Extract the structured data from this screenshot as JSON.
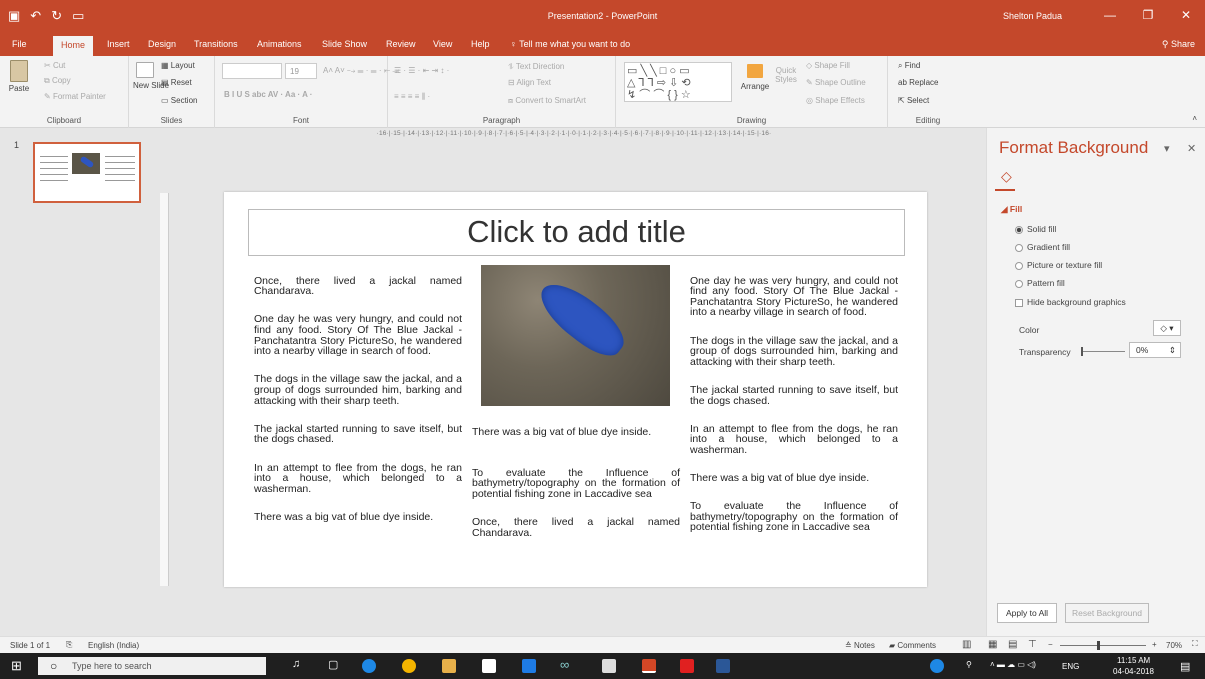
{
  "window": {
    "title": "Presentation2  -  PowerPoint",
    "user": "Shelton Padua"
  },
  "tabs": [
    "File",
    "Home",
    "Insert",
    "Design",
    "Transitions",
    "Animations",
    "Slide Show",
    "Review",
    "View",
    "Help"
  ],
  "tell_me": "Tell me what you want to do",
  "share": "Share",
  "ribbon": {
    "clipboard": {
      "label": "Clipboard",
      "paste": "Paste",
      "cut": "Cut",
      "copy": "Copy",
      "format_painter": "Format Painter"
    },
    "slides": {
      "label": "Slides",
      "new_slide": "New Slide",
      "layout": "Layout",
      "reset": "Reset",
      "section": "Section"
    },
    "font": {
      "label": "Font",
      "size": "19"
    },
    "paragraph": {
      "label": "Paragraph",
      "text_direction": "Text Direction",
      "align_text": "Align Text",
      "convert_smartart": "Convert to SmartArt"
    },
    "drawing": {
      "label": "Drawing",
      "arrange": "Arrange",
      "quick_styles": "Quick Styles",
      "shape_fill": "Shape Fill",
      "shape_outline": "Shape Outline",
      "shape_effects": "Shape Effects"
    },
    "editing": {
      "label": "Editing",
      "find": "Find",
      "replace": "Replace",
      "select": "Select"
    }
  },
  "ruler": "·16·|·15·|·14·|·13·|·12·|·11·|·10·|·9·|·8·|·7·|·6·|·5·|·4·|·3·|·2·|·1·|·0·|·1·|·2·|·3·|·4·|·5·|·6·|·7·|·8·|·9·|·10·|·11·|·12·|·13·|·14·|·15·|·16·",
  "thumb_number": "1",
  "slide": {
    "title_placeholder": "Click to add title",
    "col1": [
      "Once, there lived a jackal named Chandarava.",
      "One day he was very hungry, and could not find any food. Story Of The Blue Jackal - Panchatantra Story PictureSo, he wandered into a nearby village in search of food.",
      "The dogs in the village saw the jackal, and a group of dogs surrounded him, barking and attacking with their sharp teeth.",
      "The jackal started running to save itself, but the dogs chased.",
      "In an attempt to flee from the dogs, he ran into a house, which belonged to a washerman.",
      "There was a big vat of blue dye inside."
    ],
    "col2": [
      "There was a big vat of blue dye inside.",
      "To evaluate the Influence of bathymetry/topography on the formation of potential fishing zone in Laccadive sea",
      "Once, there lived a jackal named Chandarava."
    ],
    "col3": [
      "One day he was very hungry, and could not find any food. Story Of The Blue Jackal - Panchatantra Story PictureSo, he wandered into a nearby village in search of food.",
      "The dogs in the village saw the jackal, and a group of dogs surrounded him, barking and attacking with their sharp teeth.",
      "The jackal started running to save itself, but the dogs chased.",
      "In an attempt to flee from the dogs, he ran into a house, which belonged to a washerman.",
      "There was a big vat of blue dye inside.",
      "To evaluate the Influence of bathymetry/topography on the formation of potential fishing zone in Laccadive sea"
    ]
  },
  "format_pane": {
    "title": "Format Background",
    "section": "Fill",
    "options": [
      "Solid fill",
      "Gradient fill",
      "Picture or texture fill",
      "Pattern fill"
    ],
    "hide_graphics": "Hide background graphics",
    "color_label": "Color",
    "transparency_label": "Transparency",
    "transparency_value": "0%",
    "apply_all": "Apply to All",
    "reset_bg": "Reset Background"
  },
  "status": {
    "slide": "Slide 1 of 1",
    "language": "English (India)",
    "notes": "Notes",
    "comments": "Comments",
    "zoom": "70%"
  },
  "taskbar": {
    "search": "Type here to search",
    "lang": "ENG",
    "time": "11:15 AM",
    "date": "04-04-2018"
  },
  "colors": {
    "accent": "#c4482b",
    "slipper": "#2d55c0"
  }
}
